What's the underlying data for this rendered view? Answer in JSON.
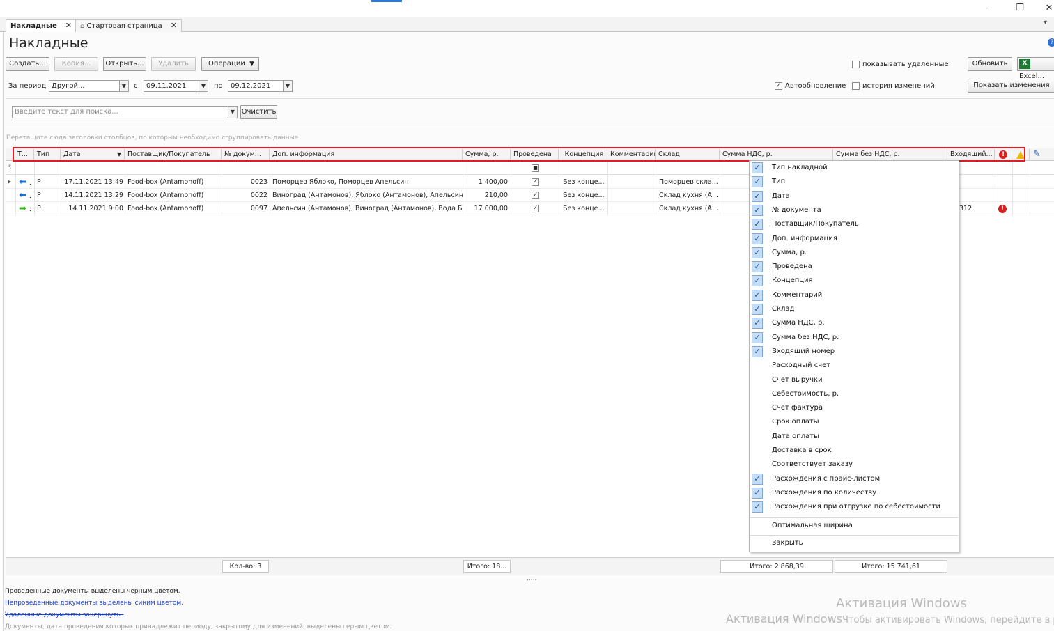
{
  "window": {
    "minimize": "–",
    "restore": "❐",
    "close": "✕"
  },
  "tabs": [
    {
      "label": "Накладные",
      "close": "✕"
    },
    {
      "icon": "home-icon",
      "label": "Стартовая страница",
      "close": "✕"
    }
  ],
  "tab_overflow": "▾",
  "page_title": "Накладные",
  "toolbar": {
    "create": "Создать...",
    "copy": "Копия...",
    "open": "Открыть...",
    "delete": "Удалить",
    "operations": "Операции",
    "show_deleted": "показывать удаленные",
    "refresh": "Обновить",
    "excel": "Excel..."
  },
  "period": {
    "label": "За период",
    "value": "Другой...",
    "from_label": "с",
    "from": "09.11.2021",
    "to_label": "по",
    "to": "09.12.2021",
    "autorefresh": "Автообновление",
    "history": "история изменений",
    "show_changes": "Показать изменения"
  },
  "search": {
    "placeholder": "Введите текст для поиска...",
    "clear": "Очистить"
  },
  "group_hint": "Перетащите сюда заголовки столбцов, по которым необходимо сгруппировать данные",
  "columns": [
    "Т...",
    "Тип",
    "Дата",
    "Поставщик/Покупатель",
    "№ докум...",
    "Доп. информация",
    "Сумма, р.",
    "Проведена",
    "Концепция",
    "Комментарий",
    "Склад",
    "Сумма НДС, р.",
    "Сумма без НДС, р.",
    "Входящий..."
  ],
  "rows": [
    {
      "direction": "in",
      "type": "Р",
      "date": "17.11.2021 13:49",
      "supplier": "Food-box (Antamonoff)",
      "num": "0023",
      "info": "Поморцев Яблоко, Поморцев Апельсин",
      "sum": "1 400,00",
      "posted": true,
      "concept": "Без конце...",
      "comment": "",
      "store": "Поморцев скла..."
    },
    {
      "direction": "in",
      "type": "Р",
      "date": "14.11.2021 13:29",
      "supplier": "Food-box (Antamonoff)",
      "num": "0022",
      "info": "Виноград (Антамонов), Яблоко (Антамонов), Апельсин...",
      "sum": "210,00",
      "posted": true,
      "concept": "Без конце...",
      "comment": "",
      "store": "Склад кухня (А..."
    },
    {
      "direction": "out",
      "type": "Р",
      "date": "14.11.2021 9:00",
      "supplier": "Food-box (Antamonoff)",
      "num": "0097",
      "info": "Апельсин (Антамонов), Виноград (Антамонов), Вода Б...",
      "sum": "17 000,00",
      "posted": true,
      "concept": "Без конце...",
      "comment": "",
      "store": "Склад кухня (А...",
      "incoming": "312",
      "error": true
    }
  ],
  "column_menu": [
    {
      "label": "Тип накладной",
      "checked": true
    },
    {
      "label": "Тип",
      "checked": true
    },
    {
      "label": "Дата",
      "checked": true
    },
    {
      "label": "№ документа",
      "checked": true
    },
    {
      "label": "Поставщик/Покупатель",
      "checked": true
    },
    {
      "label": "Доп. информация",
      "checked": true
    },
    {
      "label": "Сумма, р.",
      "checked": true
    },
    {
      "label": "Проведена",
      "checked": true
    },
    {
      "label": "Концепция",
      "checked": true
    },
    {
      "label": "Комментарий",
      "checked": true
    },
    {
      "label": "Склад",
      "checked": true
    },
    {
      "label": "Сумма НДС, р.",
      "checked": true
    },
    {
      "label": "Сумма без НДС, р.",
      "checked": true
    },
    {
      "label": "Входящий номер",
      "checked": true
    },
    {
      "label": "Расходный счет",
      "checked": false
    },
    {
      "label": "Счет выручки",
      "checked": false
    },
    {
      "label": "Себестоимость, р.",
      "checked": false
    },
    {
      "label": "Счет фактура",
      "checked": false
    },
    {
      "label": "Срок оплаты",
      "checked": false
    },
    {
      "label": "Дата оплаты",
      "checked": false
    },
    {
      "label": "Доставка в срок",
      "checked": false
    },
    {
      "label": "Соответствует заказу",
      "checked": false
    },
    {
      "label": "Расхождения с прайс-листом",
      "checked": true
    },
    {
      "label": "Расхождения по количеству",
      "checked": true
    },
    {
      "label": "Расхождения при отгрузке по себестоимости",
      "checked": true
    }
  ],
  "menu_extra": {
    "optimal": "Оптимальная ширина",
    "close": "Закрыть"
  },
  "totals": {
    "count": "Кол-во: 3",
    "sum": "Итого: 18...",
    "vat": "Итого: 2 868,39",
    "novat": "Итого: 15 741,61"
  },
  "splitter": ".....",
  "legend": [
    {
      "text": "Проведенные документы выделены черным цветом.",
      "color": "#222222"
    },
    {
      "text": "Непроведенные документы выделены синим цветом.",
      "color": "#1a3fd6"
    },
    {
      "text": "Удаленные документы зачеркнуты.",
      "color": "#1a3fd6"
    },
    {
      "text": "Документы, дата проведения которых принадлежит периоду, закрытому для изменений, выделены серым цветом.",
      "color": "#9a9a9a"
    }
  ],
  "watermark": {
    "title": "Активация Windows",
    "line2a": "Активация Windows",
    "line2b": "Чтобы активировать Windows, перейдите в р"
  }
}
